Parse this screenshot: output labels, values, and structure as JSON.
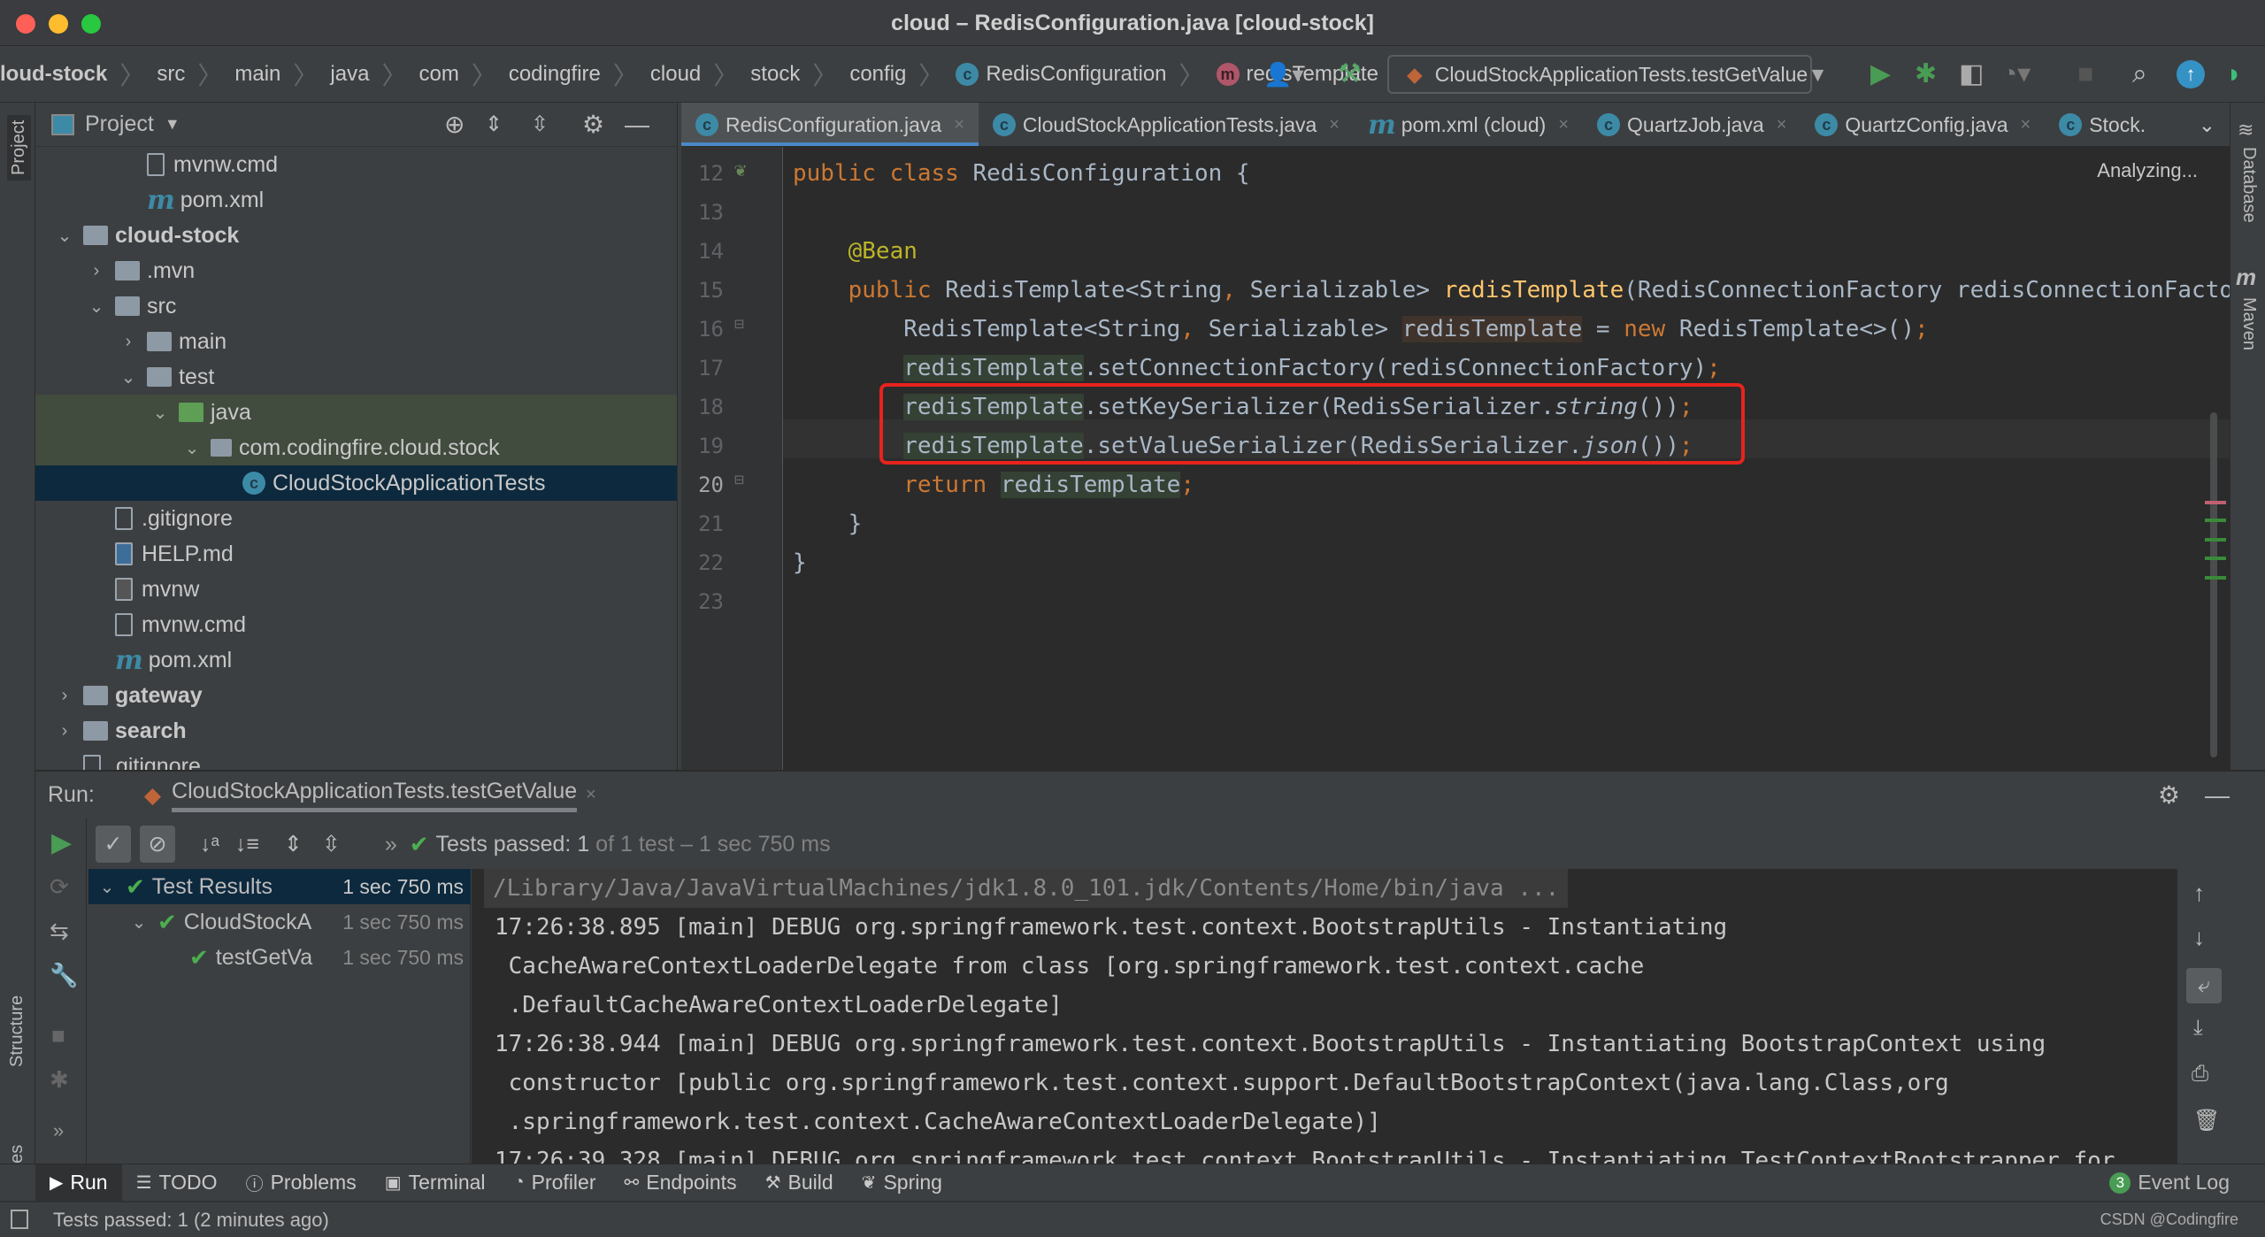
{
  "window": {
    "title": "cloud – RedisConfiguration.java [cloud-stock]"
  },
  "breadcrumb": [
    "loud-stock",
    "src",
    "main",
    "java",
    "com",
    "codingfire",
    "cloud",
    "stock",
    "config",
    "RedisConfiguration",
    "redisTemplate"
  ],
  "toolbar": {
    "run_config": "CloudStockApplicationTests.testGetValue"
  },
  "project_panel": {
    "title": "Project",
    "side_label": "Project",
    "tree": [
      {
        "label": "mvnw.cmd",
        "level": 3,
        "icon": "file"
      },
      {
        "label": "pom.xml",
        "level": 3,
        "icon": "maven"
      },
      {
        "label": "cloud-stock",
        "level": 1,
        "icon": "module-folder",
        "arrow": "open",
        "bold": true
      },
      {
        "label": ".mvn",
        "level": 2,
        "icon": "folder",
        "arrow": "closed"
      },
      {
        "label": "src",
        "level": 2,
        "icon": "folder",
        "arrow": "open"
      },
      {
        "label": "main",
        "level": 3,
        "icon": "folder",
        "arrow": "closed"
      },
      {
        "label": "test",
        "level": 3,
        "icon": "folder",
        "arrow": "open"
      },
      {
        "label": "java",
        "level": 4,
        "icon": "test-folder",
        "arrow": "open",
        "tint": true
      },
      {
        "label": "com.codingfire.cloud.stock",
        "level": 5,
        "icon": "package",
        "arrow": "open",
        "tint": true
      },
      {
        "label": "CloudStockApplicationTests",
        "level": 6,
        "icon": "class",
        "selected": true
      },
      {
        "label": ".gitignore",
        "level": 2,
        "icon": "file"
      },
      {
        "label": "HELP.md",
        "level": 2,
        "icon": "markdown"
      },
      {
        "label": "mvnw",
        "level": 2,
        "icon": "terminal"
      },
      {
        "label": "mvnw.cmd",
        "level": 2,
        "icon": "file"
      },
      {
        "label": "pom.xml",
        "level": 2,
        "icon": "maven"
      },
      {
        "label": "gateway",
        "level": 1,
        "icon": "module-folder",
        "arrow": "closed",
        "bold": true
      },
      {
        "label": "search",
        "level": 1,
        "icon": "module-folder",
        "arrow": "closed",
        "bold": true
      },
      {
        "label": ".gitignore",
        "level": 1,
        "icon": "file"
      }
    ]
  },
  "editor_tabs": [
    {
      "label": "RedisConfiguration.java",
      "icon": "class",
      "active": true
    },
    {
      "label": "CloudStockApplicationTests.java",
      "icon": "class"
    },
    {
      "label": "pom.xml (cloud)",
      "icon": "maven"
    },
    {
      "label": "QuartzJob.java",
      "icon": "class"
    },
    {
      "label": "QuartzConfig.java",
      "icon": "class"
    },
    {
      "label": "Stock.",
      "icon": "class"
    }
  ],
  "editor": {
    "status": "Analyzing...",
    "current_line": 20,
    "lines": [
      {
        "n": "12",
        "tokens": [
          {
            "t": "public class ",
            "k": "kw"
          },
          {
            "t": "RedisConfiguration {"
          }
        ]
      },
      {
        "n": "13",
        "tokens": []
      },
      {
        "n": "14",
        "tokens": [
          {
            "t": "    "
          },
          {
            "t": "@Bean",
            "k": "ann"
          }
        ]
      },
      {
        "n": "15",
        "tokens": [
          {
            "t": "    "
          },
          {
            "t": "public ",
            "k": "kw"
          },
          {
            "t": "RedisTemplate<String"
          },
          {
            "t": ",",
            "k": "kw"
          },
          {
            "t": " Serializable> "
          },
          {
            "t": "redisTemplate",
            "k": "fn"
          },
          {
            "t": "(RedisConnectionFactory redisConnectionFactory) {"
          }
        ]
      },
      {
        "n": "16",
        "tokens": [
          {
            "t": "        RedisTemplate<String"
          },
          {
            "t": ",",
            "k": "kw"
          },
          {
            "t": " Serializable> "
          },
          {
            "t": "redisTemplate",
            "k": "hlw"
          },
          {
            "t": " = "
          },
          {
            "t": "new ",
            "k": "kw"
          },
          {
            "t": "RedisTemplate<>()"
          },
          {
            "t": ";",
            "k": "kw"
          }
        ]
      },
      {
        "n": "17",
        "tokens": [
          {
            "t": "        "
          },
          {
            "t": "redisTemplate",
            "k": "hl"
          },
          {
            "t": ".setConnectionFactory(redisConnectionFactory)"
          },
          {
            "t": ";",
            "k": "kw"
          }
        ]
      },
      {
        "n": "18",
        "tokens": [
          {
            "t": "        "
          },
          {
            "t": "redisTemplate",
            "k": "hl"
          },
          {
            "t": ".setKeySerializer(RedisSerializer."
          },
          {
            "t": "string",
            "k": "it"
          },
          {
            "t": "())"
          },
          {
            "t": ";",
            "k": "kw"
          }
        ]
      },
      {
        "n": "19",
        "tokens": [
          {
            "t": "        "
          },
          {
            "t": "redisTemplate",
            "k": "hl"
          },
          {
            "t": ".setValueSerializer(RedisSerializer."
          },
          {
            "t": "json",
            "k": "it"
          },
          {
            "t": "())"
          },
          {
            "t": ";",
            "k": "kw"
          }
        ]
      },
      {
        "n": "20",
        "tokens": [
          {
            "t": "        "
          },
          {
            "t": "return ",
            "k": "kw"
          },
          {
            "t": "redisTemplate",
            "k": "hl"
          },
          {
            "t": ";",
            "k": "kw"
          }
        ]
      },
      {
        "n": "21",
        "tokens": [
          {
            "t": "    }"
          }
        ]
      },
      {
        "n": "22",
        "tokens": [
          {
            "t": "}"
          }
        ]
      },
      {
        "n": "23",
        "tokens": []
      }
    ]
  },
  "right_strip": {
    "database": "Database",
    "maven": "Maven"
  },
  "run_panel": {
    "label": "Run:",
    "tab": "CloudStockApplicationTests.testGetValue",
    "status_strong": "Tests passed: 1",
    "status_rest": " of 1 test – 1 sec 750 ms",
    "tests": [
      {
        "label": "Test Results",
        "time": "1 sec 750 ms",
        "level": 0,
        "selected": true
      },
      {
        "label": "CloudStockA",
        "time": "1 sec 750 ms",
        "level": 1
      },
      {
        "label": "testGetVa",
        "time": "1 sec 750 ms",
        "level": 2
      }
    ],
    "console": [
      "/Library/Java/JavaVirtualMachines/jdk1.8.0_101.jdk/Contents/Home/bin/java ...",
      "17:26:38.895 [main] DEBUG org.springframework.test.context.BootstrapUtils - Instantiating",
      " CacheAwareContextLoaderDelegate from class [org.springframework.test.context.cache",
      " .DefaultCacheAwareContextLoaderDelegate]",
      "17:26:38.944 [main] DEBUG org.springframework.test.context.BootstrapUtils - Instantiating BootstrapContext using",
      " constructor [public org.springframework.test.context.support.DefaultBootstrapContext(java.lang.Class,org",
      " .springframework.test.context.CacheAwareContextLoaderDelegate)]",
      "17:26:39.328 [main] DEBUG org.springframework.test.context.BootstrapUtils - Instantiating TestContextBootstrapper for"
    ]
  },
  "left_strip": {
    "structure": "Structure",
    "favorites": "Favorites"
  },
  "bottom_tabs": [
    {
      "label": "Run",
      "icon": "play",
      "active": true
    },
    {
      "label": "TODO",
      "icon": "list"
    },
    {
      "label": "Problems",
      "icon": "info"
    },
    {
      "label": "Terminal",
      "icon": "terminal"
    },
    {
      "label": "Profiler",
      "icon": "profiler"
    },
    {
      "label": "Endpoints",
      "icon": "endpoints"
    },
    {
      "label": "Build",
      "icon": "hammer"
    },
    {
      "label": "Spring",
      "icon": "spring"
    }
  ],
  "event_log": {
    "count": "3",
    "label": "Event Log"
  },
  "status_bar": {
    "text": "Tests passed: 1 (2 minutes ago)",
    "watermark": "CSDN @Codingfire"
  }
}
